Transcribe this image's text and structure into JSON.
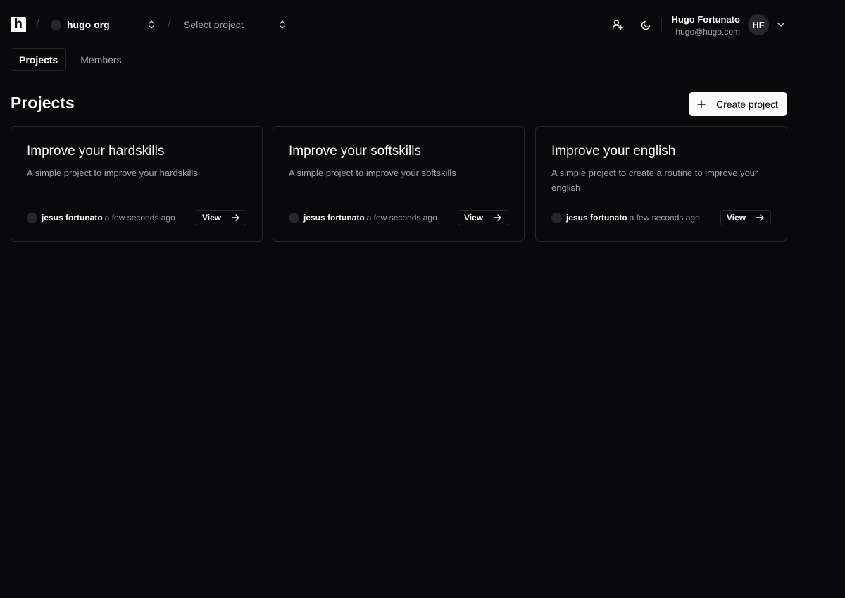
{
  "header": {
    "logo_letter": "h",
    "separator": "/",
    "org_name": "hugo org",
    "project_placeholder": "Select project",
    "user": {
      "name": "Hugo Fortunato",
      "email": "hugo@hugo.com",
      "initials": "HF"
    },
    "icons": [
      "logo-icon",
      "chevron-up-down-icon",
      "add-user-icon",
      "moon-icon",
      "chevron-down-icon"
    ]
  },
  "tabs": [
    {
      "label": "Projects",
      "active": true
    },
    {
      "label": "Members",
      "active": false
    }
  ],
  "page": {
    "title": "Projects",
    "create_label": "Create project"
  },
  "projects": [
    {
      "title": "Improve your hardskills",
      "description": "A simple project to improve your hardskills",
      "author": "jesus fortunato",
      "time": "a few seconds ago",
      "view_label": "View"
    },
    {
      "title": "Improve your softskills",
      "description": "A simple project to improve your softskills",
      "author": "jesus fortunato",
      "time": "a few seconds ago",
      "view_label": "View"
    },
    {
      "title": "Improve your english",
      "description": "A simple project to create a routine to improve your english",
      "author": "jesus fortunato",
      "time": "a few seconds ago",
      "view_label": "View"
    }
  ],
  "colors": {
    "background": "#09090b",
    "border": "#27272a",
    "foreground": "#fafafa",
    "muted": "#a1a1aa"
  }
}
